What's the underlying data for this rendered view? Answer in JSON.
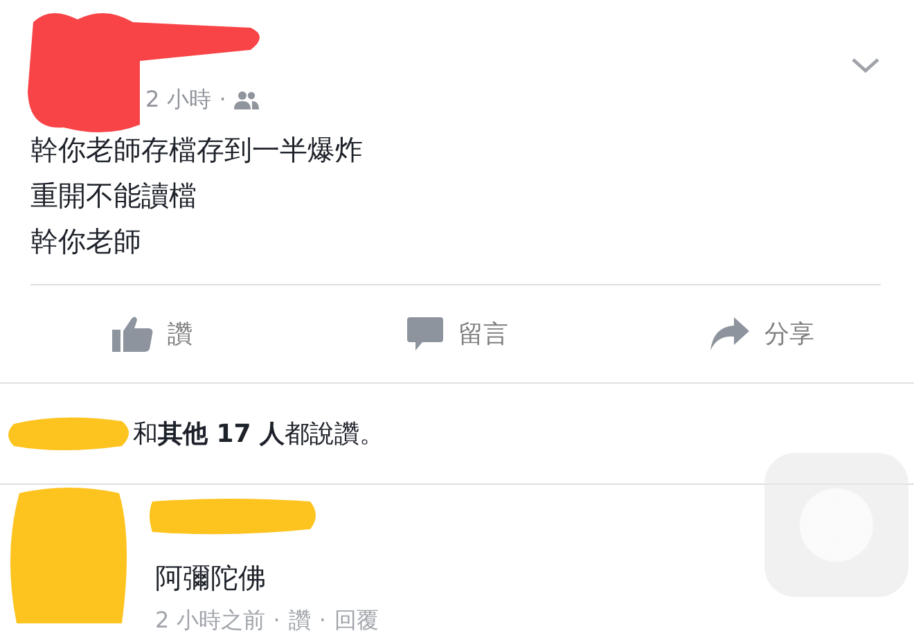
{
  "post": {
    "time": "2 小時",
    "separator": "·",
    "lines": [
      "幹你老師存檔存到一半爆炸",
      "重開不能讀檔",
      "幹你老師"
    ]
  },
  "actions": [
    {
      "kind": "like",
      "label": "讚"
    },
    {
      "kind": "comment",
      "label": "留言"
    },
    {
      "kind": "share",
      "label": "分享"
    }
  ],
  "likes_summary": "和**其他 17 人**都說讚。",
  "comment": {
    "text": "阿彌陀佛",
    "time": "2 小時之前",
    "links": [
      "讚",
      "回覆"
    ]
  }
}
